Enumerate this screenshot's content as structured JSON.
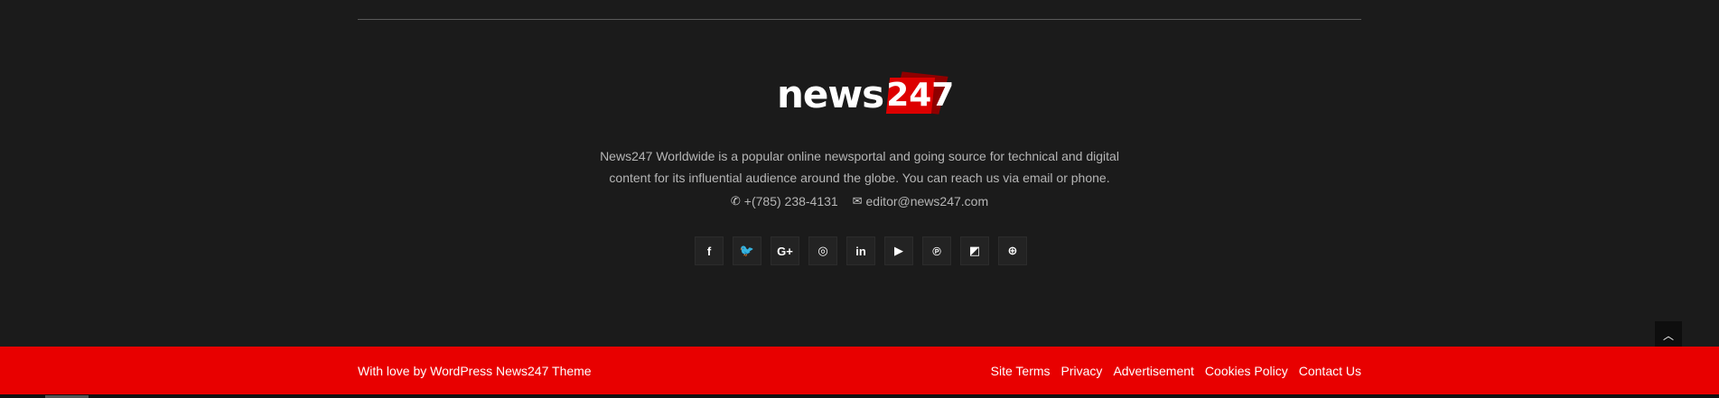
{
  "logo": {
    "word": "news",
    "number": "247"
  },
  "about": {
    "line1": "News247 Worldwide is a popular online newsportal and going source for technical and digital",
    "line2": "content for its influential audience around the globe. You can reach us via email or phone."
  },
  "contacts": {
    "phone": "+(785) 238-4131",
    "email": "editor@news247.com"
  },
  "social": [
    {
      "name": "facebook",
      "glyph": "f"
    },
    {
      "name": "twitter",
      "glyph": "🐦"
    },
    {
      "name": "google-plus",
      "glyph": "G+"
    },
    {
      "name": "instagram",
      "glyph": "◎"
    },
    {
      "name": "linkedin",
      "glyph": "in"
    },
    {
      "name": "youtube",
      "glyph": "▶"
    },
    {
      "name": "pinterest",
      "glyph": "℗"
    },
    {
      "name": "delicious",
      "glyph": "◩"
    },
    {
      "name": "dribbble",
      "glyph": "⊕"
    }
  ],
  "footer": {
    "credit": "With love by WordPress News247 Theme",
    "links": [
      "Site Terms",
      "Privacy",
      "Advertisement",
      "Cookies Policy",
      "Contact Us"
    ]
  },
  "colors": {
    "background": "#1b1b1b",
    "accent": "#e80000"
  }
}
